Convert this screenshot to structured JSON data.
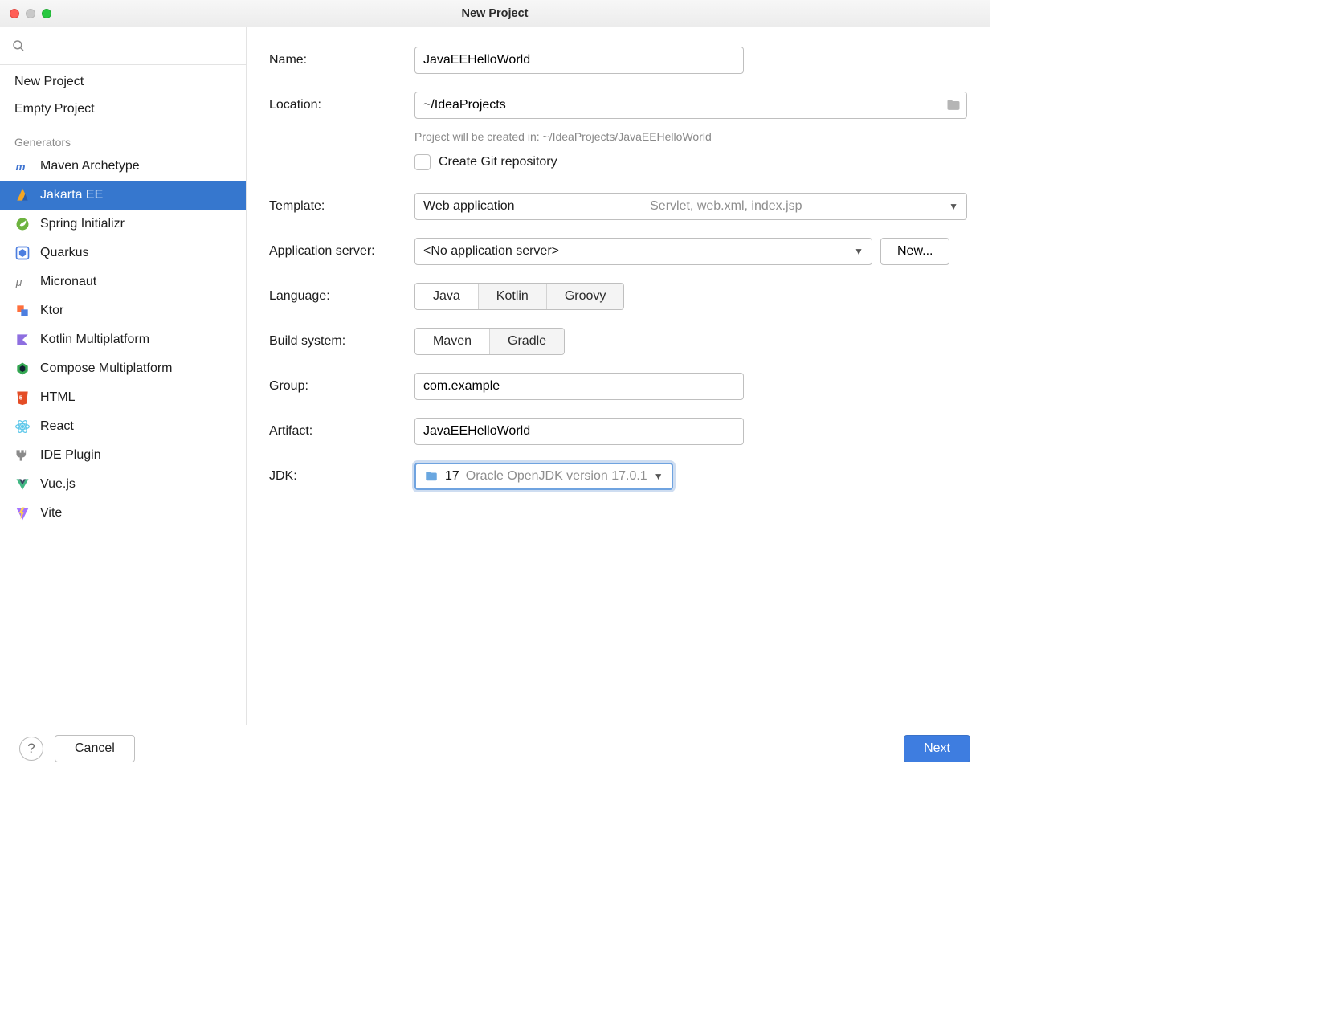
{
  "window": {
    "title": "New Project"
  },
  "sidebar": {
    "search_placeholder": "",
    "items_top": [
      {
        "label": "New Project"
      },
      {
        "label": "Empty Project"
      }
    ],
    "generators_header": "Generators",
    "generators": [
      {
        "label": "Maven Archetype",
        "icon": "maven"
      },
      {
        "label": "Jakarta EE",
        "icon": "jakarta",
        "selected": true
      },
      {
        "label": "Spring Initializr",
        "icon": "spring"
      },
      {
        "label": "Quarkus",
        "icon": "quarkus"
      },
      {
        "label": "Micronaut",
        "icon": "micronaut"
      },
      {
        "label": "Ktor",
        "icon": "ktor"
      },
      {
        "label": "Kotlin Multiplatform",
        "icon": "kotlin"
      },
      {
        "label": "Compose Multiplatform",
        "icon": "compose"
      },
      {
        "label": "HTML",
        "icon": "html"
      },
      {
        "label": "React",
        "icon": "react"
      },
      {
        "label": "IDE Plugin",
        "icon": "plug"
      },
      {
        "label": "Vue.js",
        "icon": "vue"
      },
      {
        "label": "Vite",
        "icon": "vite"
      }
    ]
  },
  "form": {
    "name_label": "Name:",
    "name_value": "JavaEEHelloWorld",
    "location_label": "Location:",
    "location_value": "~/IdeaProjects",
    "location_hint": "Project will be created in: ~/IdeaProjects/JavaEEHelloWorld",
    "git_checkbox_label": "Create Git repository",
    "git_checkbox_checked": false,
    "template_label": "Template:",
    "template_value": "Web application",
    "template_extra": "Servlet, web.xml, index.jsp",
    "appserver_label": "Application server:",
    "appserver_value": "<No application server>",
    "appserver_new_button": "New...",
    "language_label": "Language:",
    "language_options": [
      "Java",
      "Kotlin",
      "Groovy"
    ],
    "language_selected": "Java",
    "build_label": "Build system:",
    "build_options": [
      "Maven",
      "Gradle"
    ],
    "build_selected": "Maven",
    "group_label": "Group:",
    "group_value": "com.example",
    "artifact_label": "Artifact:",
    "artifact_value": "JavaEEHelloWorld",
    "jdk_label": "JDK:",
    "jdk_version": "17",
    "jdk_detail": "Oracle OpenJDK version 17.0.1"
  },
  "footer": {
    "help_tooltip": "?",
    "cancel": "Cancel",
    "next": "Next"
  }
}
